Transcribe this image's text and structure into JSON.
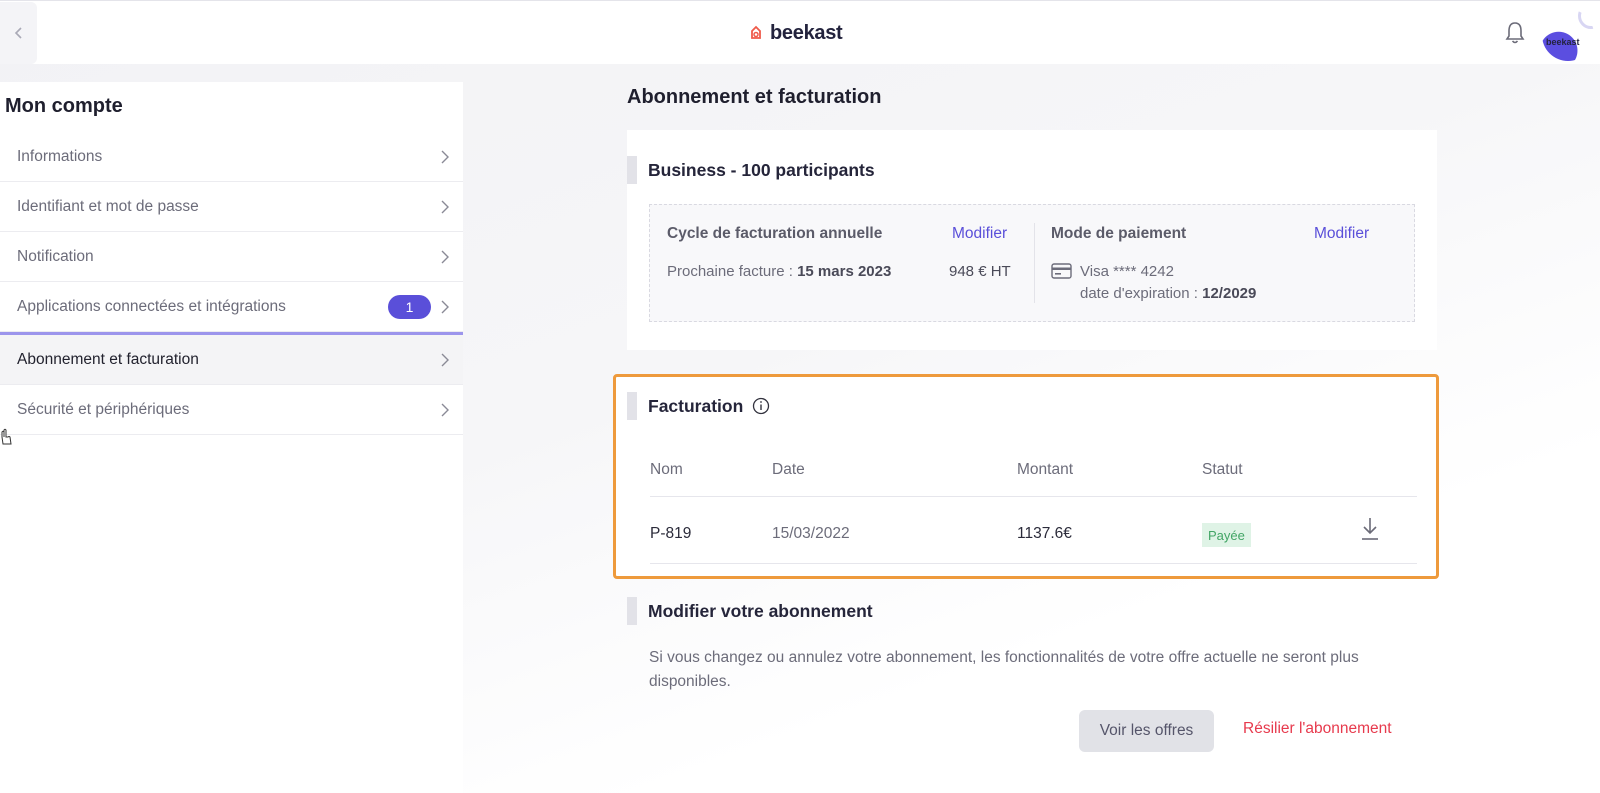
{
  "header": {
    "logo_text": "beekast",
    "avatar_text": "beekast"
  },
  "sidebar": {
    "title": "Mon compte",
    "items": [
      {
        "label": "Informations"
      },
      {
        "label": "Identifiant et mot de passe"
      },
      {
        "label": "Notification"
      },
      {
        "label": "Applications connectées et intégrations",
        "badge": "1"
      },
      {
        "label": "Abonnement et facturation",
        "active": true
      },
      {
        "label": "Sécurité et périphériques"
      }
    ]
  },
  "main": {
    "title": "Abonnement et facturation",
    "plan": {
      "name": "Business - 100 participants",
      "cycle_label": "Cycle de facturation annuelle",
      "cycle_modify": "Modifier",
      "next_invoice_prefix": "Prochaine facture :",
      "next_invoice_date": "15 mars 2023",
      "amount": "948 € HT",
      "payment_label": "Mode de paiement",
      "payment_modify": "Modifier",
      "card": "Visa **** 4242",
      "expiry_prefix": "date d'expiration :",
      "expiry_date": "12/2029"
    },
    "billing": {
      "title": "Facturation",
      "columns": [
        "Nom",
        "Date",
        "Montant",
        "Statut"
      ],
      "rows": [
        {
          "name": "P-819",
          "date": "15/03/2022",
          "amount": "1137.6€",
          "status": "Payée"
        }
      ]
    },
    "change": {
      "title": "Modifier votre abonnement",
      "description": "Si vous changez ou annulez votre abonnement, les fonctionnalités de votre offre actuelle ne seront plus disponibles.",
      "offers_button": "Voir les offres",
      "cancel_link": "Résilier l'abonnement"
    }
  },
  "colors": {
    "accent": "#5a4fd9",
    "highlight_border": "#ee9a3c",
    "danger": "#e73a4d",
    "paid_badge_bg": "#dff3e6",
    "paid_badge_text": "#42a565"
  }
}
